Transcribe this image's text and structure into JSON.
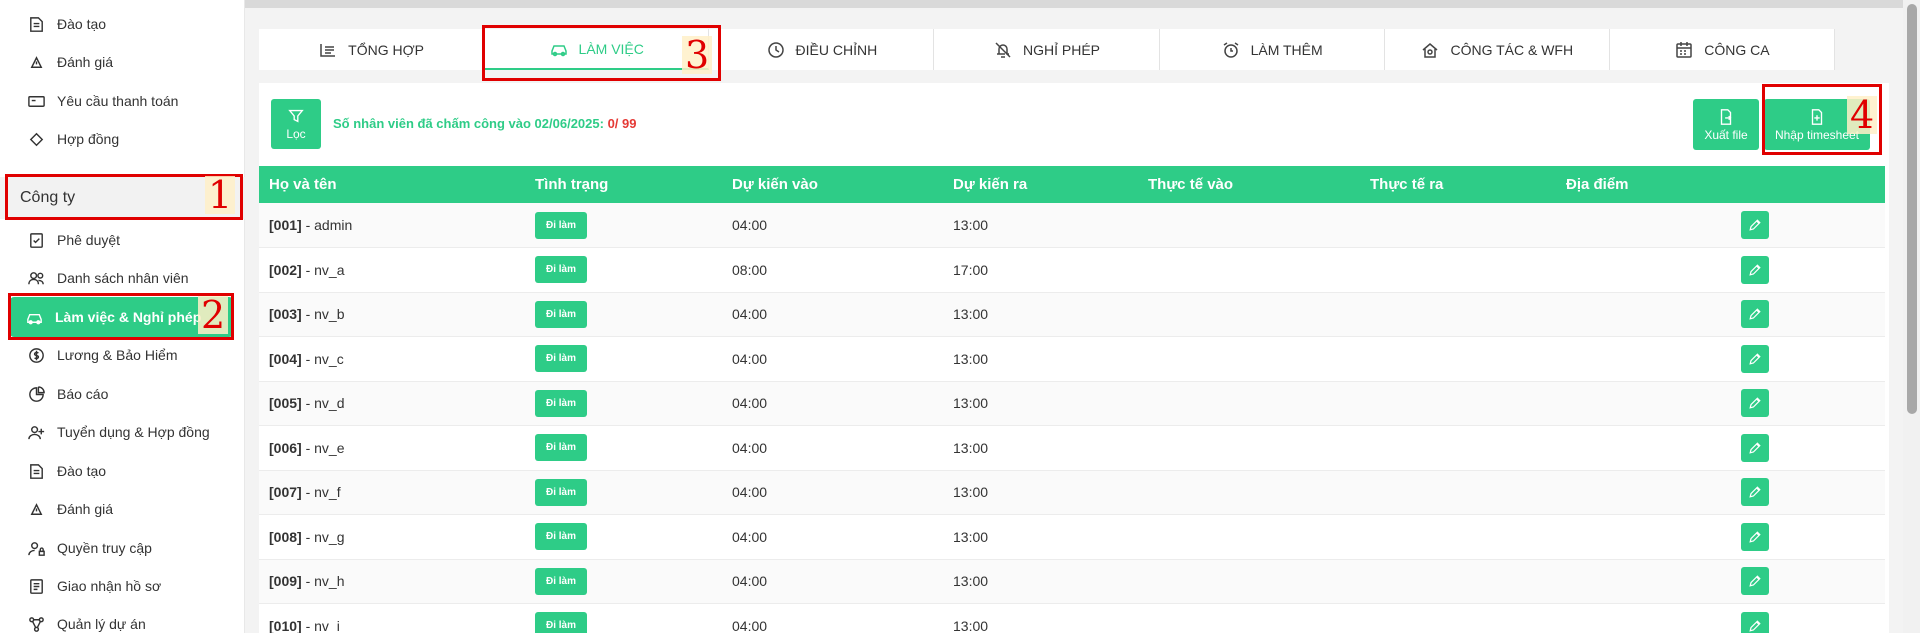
{
  "sidebar": {
    "top_items": [
      {
        "label": "Đào tạo",
        "icon": "training-icon"
      },
      {
        "label": "Đánh giá",
        "icon": "evaluation-icon"
      },
      {
        "label": "Yêu cầu thanh toán",
        "icon": "payment-icon"
      },
      {
        "label": "Hợp đồng",
        "icon": "contract-icon"
      }
    ],
    "section_title": "Công ty",
    "company_items": [
      {
        "label": "Phê duyệt",
        "icon": "approval-icon"
      },
      {
        "label": "Danh sách nhân viên",
        "icon": "users-icon"
      },
      {
        "label": "Làm việc & Nghỉ phép",
        "icon": "car-work-icon",
        "active": true
      },
      {
        "label": "Lương & Bảo Hiểm",
        "icon": "dollar-icon"
      },
      {
        "label": "Báo cáo",
        "icon": "pie-chart-icon"
      },
      {
        "label": "Tuyển dụng & Hợp đồng",
        "icon": "user-plus-icon"
      },
      {
        "label": "Đào tạo",
        "icon": "training-icon"
      },
      {
        "label": "Đánh giá",
        "icon": "evaluation-icon"
      },
      {
        "label": "Quyền truy cập",
        "icon": "user-lock-icon"
      },
      {
        "label": "Giao nhận hồ sơ",
        "icon": "document-icon"
      },
      {
        "label": "Quản lý dự án",
        "icon": "project-icon"
      }
    ]
  },
  "tabs": [
    {
      "label": "TỔNG HỢP",
      "icon": "list-icon"
    },
    {
      "label": "LÀM VIỆC",
      "icon": "car-work-icon",
      "active": true
    },
    {
      "label": "ĐIỀU CHỈNH",
      "icon": "clock-icon"
    },
    {
      "label": "NGHỈ PHÉP",
      "icon": "bell-off-icon"
    },
    {
      "label": "LÀM THÊM",
      "icon": "alarm-icon"
    },
    {
      "label": "CÔNG TÁC & WFH",
      "icon": "home-icon"
    },
    {
      "label": "CÔNG CA",
      "icon": "calendar-icon"
    }
  ],
  "toolbar": {
    "filter_label": "Lọc",
    "summary_text": "Số nhân viên đã chấm công vào 02/06/2025:",
    "summary_count": "0",
    "summary_total": "/ 99",
    "export_label": "Xuất file",
    "import_label": "Nhập timesheet"
  },
  "table": {
    "headers": [
      "Họ và tên",
      "Tình trạng",
      "Dự kiến vào",
      "Dự kiến ra",
      "Thực tế vào",
      "Thực tế ra",
      "Địa điểm"
    ],
    "rows": [
      {
        "code": "[001]",
        "name": " - admin",
        "status": "Đi làm",
        "in": "04:00",
        "out": "13:00"
      },
      {
        "code": "[002]",
        "name": " - nv_a",
        "status": "Đi làm",
        "in": "08:00",
        "out": "17:00"
      },
      {
        "code": "[003]",
        "name": " - nv_b",
        "status": "Đi làm",
        "in": "04:00",
        "out": "13:00"
      },
      {
        "code": "[004]",
        "name": " - nv_c",
        "status": "Đi làm",
        "in": "04:00",
        "out": "13:00"
      },
      {
        "code": "[005]",
        "name": " - nv_d",
        "status": "Đi làm",
        "in": "04:00",
        "out": "13:00"
      },
      {
        "code": "[006]",
        "name": " - nv_e",
        "status": "Đi làm",
        "in": "04:00",
        "out": "13:00"
      },
      {
        "code": "[007]",
        "name": " - nv_f",
        "status": "Đi làm",
        "in": "04:00",
        "out": "13:00"
      },
      {
        "code": "[008]",
        "name": " - nv_g",
        "status": "Đi làm",
        "in": "04:00",
        "out": "13:00"
      },
      {
        "code": "[009]",
        "name": " - nv_h",
        "status": "Đi làm",
        "in": "04:00",
        "out": "13:00"
      },
      {
        "code": "[010]",
        "name": " - nv_i",
        "status": "Đi làm",
        "in": "04:00",
        "out": "13:00"
      }
    ]
  },
  "annotations": [
    "1",
    "2",
    "3",
    "4"
  ],
  "colors": {
    "accent": "#2ecc87",
    "annotation": "#e00000",
    "count_red": "#e53935"
  }
}
